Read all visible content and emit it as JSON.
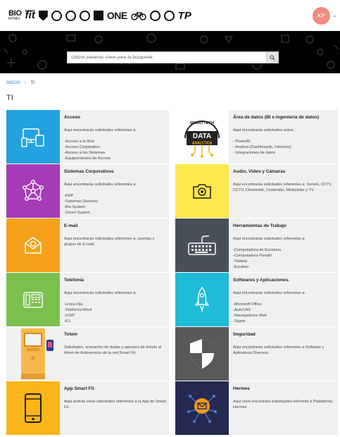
{
  "header": {
    "brands": {
      "bio": "BIO",
      "bio_sub": "RITMO",
      "fit": "fit",
      "fit_sub": "smart",
      "one": "ONE",
      "tp": "TP"
    },
    "avatar_initials": "KP"
  },
  "search": {
    "placeholder": "Utilizar palabras clave para la búsqueda"
  },
  "breadcrumb": {
    "home": "INICIO",
    "separator": "›",
    "current": "TI"
  },
  "page": {
    "title": "TI"
  },
  "colors": {
    "blue": "#22a3e0",
    "purple": "#a53bb7",
    "orange": "#f5a11b",
    "green": "#7bbf4e",
    "kiosk_orange": "#f7b84b",
    "amber": "#f9b519",
    "yellow": "#fbe84d",
    "slate": "#484f58",
    "teal": "#1ebcd6",
    "gray": "#58595b",
    "navy": "#252a52"
  },
  "cards": [
    {
      "title": "Acceso",
      "desc": "Aqui encontrarás solicitudes referentes a:",
      "items": [
        "-Acceso a la Red",
        "-Acceso Corporativo",
        "-Acceso a los Sistemas",
        "-Equipamientos de Acceso"
      ],
      "icon": "devices-icon"
    },
    {
      "title": "Área de datos (BI e ingeniería de datos)",
      "desc": "Aqui encontrarás solicitudes sobre:",
      "items": [
        "- PowerBI",
        "- Analisis (Dashboards, Informes)",
        "- Integraciones de datos"
      ],
      "icon": "data-analytics-icon",
      "tile_text": {
        "top": "SMARTTECH",
        "main": "DATA",
        "sub": "ANALYTICS"
      }
    },
    {
      "title": "Sistemas Corporativos",
      "desc": "Aqui encontrarás solicitudes referentes a:",
      "items": [
        "-ERP",
        "-Sistemas Diversos",
        "-Bio System",
        "-Smart System"
      ],
      "icon": "network-icon"
    },
    {
      "title": "Audio, Video y Cámaras",
      "desc": "Aqui encontrarás solicitudes referentes a: Sonido, CFTV, CCTV, Chromebit, Contenido, Modulador y TV.",
      "items": [],
      "icon": "camera-icon"
    },
    {
      "title": "E-mail",
      "desc": "Aqui encontrarás solicitudes referentes a: cuentas y grupos de E-mail.",
      "items": [],
      "icon": "email-icon"
    },
    {
      "title": "Herramientas de Trabajo",
      "desc": "Aqui encontrarás solicitudes referentes a:",
      "items": [
        "-Computadora de Escritorio",
        "-Computadora Portátil",
        "-Tableta",
        "-Escáner"
      ],
      "icon": "keyboard-icon"
    },
    {
      "title": "Telefonía",
      "desc": "Aqui encontrarás solicitudes referentes a:",
      "items": [
        "-Línea Fija",
        "-Telefonía Móvil",
        "-VOIP",
        "-E1"
      ],
      "icon": "phone-icon"
    },
    {
      "title": "Softwares y Aplicaciones.",
      "desc": "Aqui encontrarás solicitudes referentes a:",
      "items": [
        "-Microsoft Office",
        "-AutoCAD",
        "-Navegadores Web",
        "-Skype"
      ],
      "icon": "rocket-icon"
    },
    {
      "title": "Totem",
      "desc": "Solicitudes, aclaración de dudas y apertura de tickets al tótem de Autoservicio de la red Smart Fit.",
      "items": [],
      "icon": "kiosk-icon"
    },
    {
      "title": "Seguridad",
      "desc": "Aqui encontrarás solicitudes referentes a Software y Aplicativos Diversos.",
      "items": [],
      "icon": "shield-icon"
    },
    {
      "title": "App Smart Fit",
      "desc": "Aquí podrás crear solicitudes referentes a la App de Smart Fit.",
      "items": [],
      "icon": "smartphone-icon"
    },
    {
      "title": "Hermes",
      "desc": "Aquí vocè encontrará solicitações referente à Plataforma Hermes",
      "items": [],
      "icon": "hermes-mail-icon"
    }
  ]
}
